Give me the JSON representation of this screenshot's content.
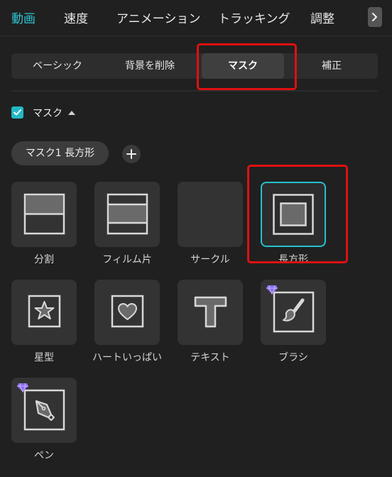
{
  "top_tabs": [
    "動画",
    "速度",
    "アニメーション",
    "トラッキング",
    "調整"
  ],
  "sub_tabs": [
    "ベーシック",
    "背景を削除",
    "マスク",
    "補正"
  ],
  "mask_section": {
    "title": "マスク",
    "checked": true,
    "current_mask": "マスク1 長方形"
  },
  "masks": [
    {
      "label": "分割",
      "icon": "split-icon"
    },
    {
      "label": "フィルム片",
      "icon": "film-strip-icon"
    },
    {
      "label": "サークル",
      "icon": "circle-icon"
    },
    {
      "label": "長方形",
      "icon": "rectangle-icon",
      "selected": true
    },
    {
      "label": "星型",
      "icon": "star-icon"
    },
    {
      "label": "ハートいっぱい",
      "icon": "heart-icon"
    },
    {
      "label": "テキスト",
      "icon": "text-icon"
    },
    {
      "label": "ブラシ",
      "icon": "brush-icon",
      "premium": true
    },
    {
      "label": "ペン",
      "icon": "pen-icon",
      "premium": true
    }
  ],
  "colors": {
    "accent": "#24c2cd",
    "highlight_box": "#e01010",
    "premium_gem": "#8c6cf0"
  }
}
